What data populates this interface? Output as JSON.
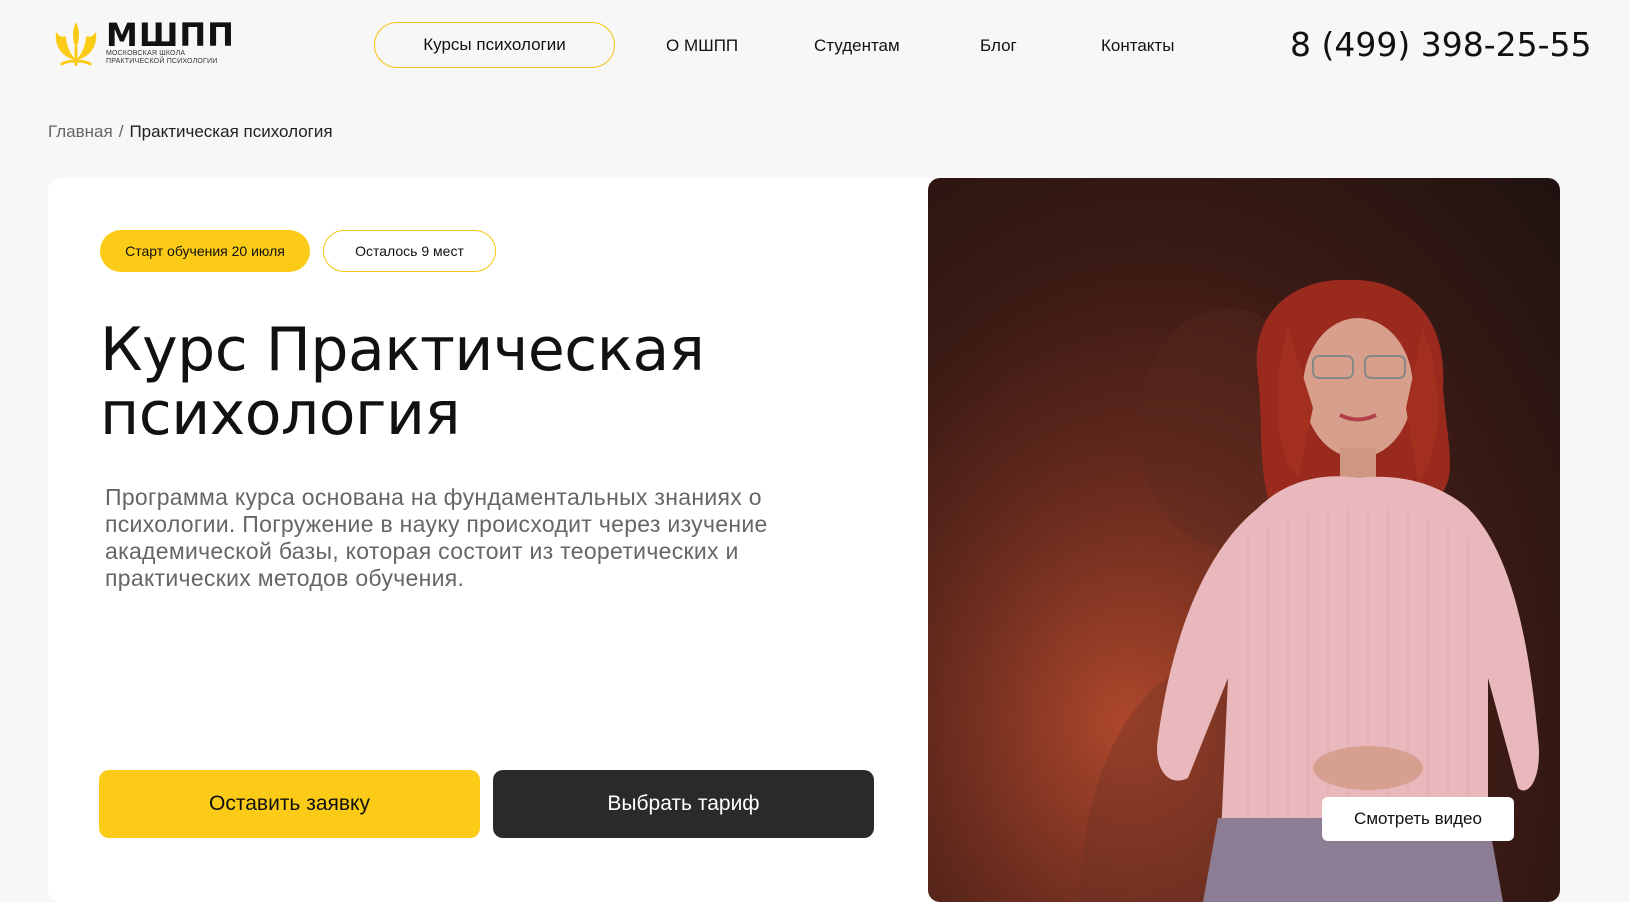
{
  "header": {
    "logo": {
      "title": "МШПП",
      "subtitle_line1": "Московская школа",
      "subtitle_line2": "практической психологии"
    },
    "nav": {
      "courses": "Курсы психологии",
      "about": "О МШПП",
      "students": "Студентам",
      "blog": "Блог",
      "contacts": "Контакты"
    },
    "phone": "8 (499) 398-25-55"
  },
  "breadcrumb": {
    "home": "Главная",
    "separator": "/",
    "current": "Практическая психология"
  },
  "hero": {
    "badge_start": "Старт обучения 20 июля",
    "badge_places": "Осталось 9 мест",
    "title": "Курс Практическая психология",
    "description": "Программа курса основана на фундаментальных знаниях о психологии. Погружение в науку происходит через изучение академической базы, которая состоит из теоретических и практических методов обучения.",
    "btn_apply": "Оставить заявку",
    "btn_tariff": "Выбрать тариф",
    "btn_video": "Смотреть видео"
  },
  "colors": {
    "accent": "#fccb17",
    "dark_button": "#2a2a2a",
    "background": "#f7f7f7"
  },
  "icons": {
    "logo": "psi-leaf-icon"
  }
}
